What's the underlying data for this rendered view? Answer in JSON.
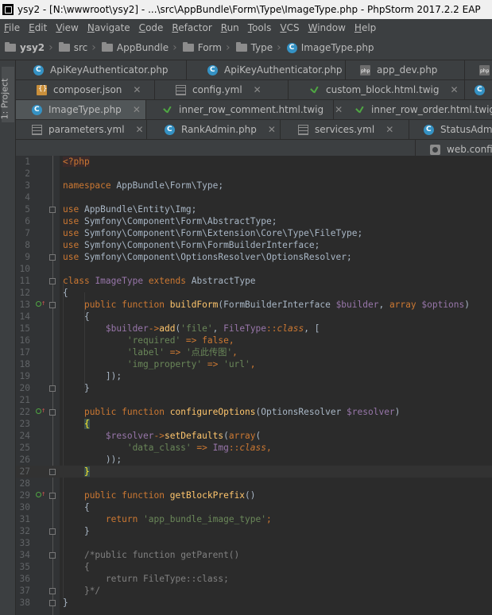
{
  "window": {
    "title": "ysy2 - [N:\\wwwroot\\ysy2] - ...\\src\\AppBundle\\Form\\Type\\ImageType.php - PhpStorm 2017.2.2 EAP"
  },
  "menu": [
    "File",
    "Edit",
    "View",
    "Navigate",
    "Code",
    "Refactor",
    "Run",
    "Tools",
    "VCS",
    "Window",
    "Help"
  ],
  "breadcrumb": [
    "ysy2",
    "src",
    "AppBundle",
    "Form",
    "Type",
    "ImageType.php"
  ],
  "sidebar": {
    "project_label": "1: Project"
  },
  "tabs": {
    "row1": [
      {
        "label": "ApiKeyAuthenticator.php",
        "icon": "php-class-icon"
      },
      {
        "label": "ApiKeyAuthenticator.php",
        "icon": "php-class-icon"
      },
      {
        "label": "app_dev.php",
        "icon": "php-file-icon"
      }
    ],
    "row2": [
      {
        "label": "composer.json",
        "icon": "json-file-icon"
      },
      {
        "label": "config.yml",
        "icon": "yml-file-icon"
      },
      {
        "label": "custom_block.html.twig",
        "icon": "twig-file-icon"
      }
    ],
    "row3": [
      {
        "label": "ImageType.php",
        "icon": "php-class-icon",
        "active": true
      },
      {
        "label": "inner_row_comment.html.twig",
        "icon": "twig-file-icon"
      },
      {
        "label": "inner_row_order.html.twig",
        "icon": "twig-file-icon"
      }
    ],
    "row4": [
      {
        "label": "parameters.yml",
        "icon": "yml-file-icon"
      },
      {
        "label": "RankAdmin.php",
        "icon": "php-class-icon"
      },
      {
        "label": "services.yml",
        "icon": "yml-file-icon"
      },
      {
        "label": "StatusAdmin.",
        "icon": "php-class-icon"
      }
    ],
    "row5": [
      {
        "label": "web.confi",
        "icon": "config-file-icon"
      }
    ]
  },
  "editor": {
    "line_numbers": [
      "1",
      "2",
      "3",
      "4",
      "5",
      "6",
      "7",
      "8",
      "9",
      "10",
      "11",
      "12",
      "13",
      "14",
      "15",
      "16",
      "17",
      "18",
      "19",
      "20",
      "21",
      "22",
      "23",
      "24",
      "25",
      "26",
      "27",
      "28",
      "29",
      "30",
      "31",
      "32",
      "33",
      "34",
      "35",
      "36",
      "37",
      "38"
    ],
    "tokens": {
      "php_open": "<?php",
      "l3_kw": "namespace",
      "l3_txt": " AppBundle\\Form\\Type;",
      "use": "use",
      "l5": " AppBundle\\Entity\\Img;",
      "l6": " Symfony\\Component\\Form\\AbstractType;",
      "l7": " Symfony\\Component\\Form\\Extension\\Core\\Type\\FileType;",
      "l8": " Symfony\\Component\\Form\\FormBuilderInterface;",
      "l9": " Symfony\\Component\\OptionsResolver\\OptionsResolver;",
      "class_kw": "class",
      "class_name": "ImageType",
      "extends_kw": "extends",
      "parent": "AbstractType",
      "lbrace": "{",
      "rbrace": "}",
      "public_function": "public function",
      "fn_buildForm": "buildForm",
      "p13a": "(FormBuilderInterface ",
      "builder_var": "$builder",
      "comma_sp": ", ",
      "array_kw": "array",
      "options_var": "$options",
      "rparen": ")",
      "arrow": "->",
      "add_fn": "add",
      "lparen": "(",
      "file_str": "'file'",
      "filetype": "FileType",
      "dcolon": "::",
      "class_const": "class",
      "lbracket": ", [",
      "required_str": "'required'",
      "dbl_arrow": " => ",
      "false_kw": "false",
      "comma": ",",
      "label_str": "'label'",
      "label_val": "'点此传图'",
      "img_prop_str": "'img_property'",
      "url_str": "'url'",
      "close_bracket": "]);",
      "fn_configureOptions": "configureOptions",
      "p22a": "(OptionsResolver ",
      "resolver_var": "$resolver",
      "setDefaults_fn": "setDefaults",
      "data_class_str": "'data_class'",
      "img_cls": "Img",
      "close_paren_semicolon": "));",
      "fn_getBlockPrefix": "getBlockPrefix",
      "empty_parens": "()",
      "return_kw": "return",
      "prefix_str": "'app_bundle_image_type'",
      "semicolon": ";",
      "c34": "/*public function getParent()",
      "c35": "{",
      "c36": "    return FileType::class;",
      "c37": "}*/"
    }
  },
  "colors": {
    "editor_bg": "#2b2b2b",
    "keyword": "#cc7832",
    "function": "#ffc66d",
    "string": "#6a8759",
    "variable": "#9876aa",
    "comment": "#808080",
    "text": "#a9b7c6"
  }
}
